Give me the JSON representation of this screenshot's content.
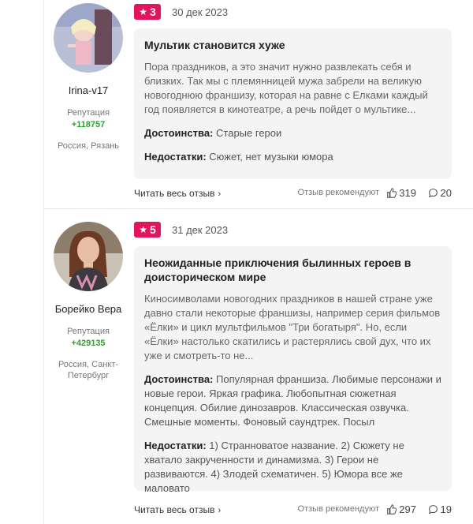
{
  "reviews": [
    {
      "author": {
        "name": "Irina-v17",
        "reputation_label": "Репутация",
        "reputation": "+118757",
        "location": "Россия, Рязань"
      },
      "rating": "3",
      "date": "30 дек 2023",
      "title": "Мультик становится хуже",
      "text": "Пора праздников, а это значит нужно развлекать себя и близких. Так мы с племянницей мужа забрели на великую новогоднюю франшизу, которая на равне с Елками каждый год появляется в кинотеатре, а речь пойдет о мультике...",
      "pros_label": "Достоинства:",
      "pros": "Старые герои",
      "cons_label": "Недостатки:",
      "cons": "Сюжет, нет музыки юмора",
      "read_more": "Читать весь отзыв",
      "recommend_label": "Отзыв рекомендуют",
      "likes": "319",
      "comments": "20"
    },
    {
      "author": {
        "name": "Борейко Вера",
        "reputation_label": "Репутация",
        "reputation": "+429135",
        "location": "Россия, Санкт-Петербург"
      },
      "rating": "5",
      "date": "31 дек 2023",
      "title": "Неожиданные приключения былинных героев в доисторическом мире",
      "text": "Киносимволами новогодних праздников в нашей стране уже давно стали некоторые франшизы, например серия фильмов «Ёлки» и цикл мультфильмов \"Три богатыря\". Но, если «Ёлки» настолько скатились и растерялись свой дух, что их уже и смотреть-то не...",
      "pros_label": "Достоинства:",
      "pros": "Популярная франшиза. Любимые персонажи и новые герои. Яркая графика. Любопытная сюжетная концепция. Обилие динозавров. Классическая озвучка. Смешные моменты. Фоновый саундтрек. Посыл",
      "cons_label": "Недостатки:",
      "cons": "1) Странноватое название. 2) Сюжету не хватало закрученности и динамизма. 3) Герои не развиваются. 4) Злодей схематичен. 5) Юмора все же маловато",
      "read_more": "Читать весь отзыв",
      "recommend_label": "Отзыв рекомендуют",
      "likes": "297",
      "comments": "19"
    }
  ],
  "colors": {
    "badge": "#e2145d",
    "reputation": "#2fa12f",
    "card_bg": "#f4f4f4"
  },
  "icons": [
    "star-icon",
    "thumb-up-icon",
    "comment-icon",
    "chevron-right-icon"
  ]
}
